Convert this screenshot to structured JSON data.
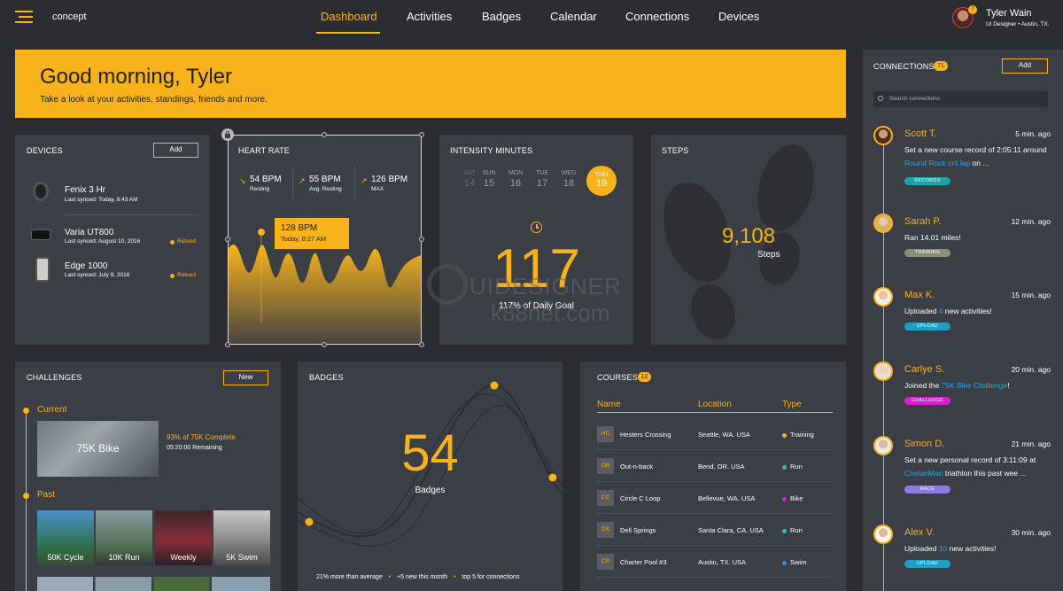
{
  "colors": {
    "accent": "#f8b31c",
    "bg": "#2b2d32",
    "card": "#3b3e45",
    "link": "#29a8e0"
  },
  "header": {
    "app_name": "concept",
    "nav": [
      "Dashboard",
      "Activities",
      "Badges",
      "Calendar",
      "Connections",
      "Devices"
    ],
    "user": {
      "name": "Tyler Wain",
      "subtitle": "UI Designer • Austin, TX.",
      "notification_count": "7"
    }
  },
  "greeting": {
    "title": "Good morning, Tyler",
    "subtitle": "Take a look at your activities, standings, friends and more."
  },
  "devices": {
    "title": "DEVICES",
    "add_label": "Add",
    "items": [
      {
        "name": "Fenix 3 Hr",
        "synced": "Last synced: Today, 8:43 AM",
        "status": ""
      },
      {
        "name": "Varia UT800",
        "synced": "Last synced: August 10, 2016",
        "status": "Retired"
      },
      {
        "name": "Edge 1000",
        "synced": "Last synced: July 9, 2016",
        "status": "Retired"
      }
    ]
  },
  "heart_rate": {
    "title": "HEART RATE",
    "stats": [
      {
        "value": "54 BPM",
        "label": "Resting"
      },
      {
        "value": "55 BPM",
        "label": "Avg. Resting"
      },
      {
        "value": "126 BPM",
        "label": "MAX"
      }
    ],
    "tooltip": {
      "value": "128 BPM",
      "time": "Today, 8:27 AM"
    }
  },
  "intensity": {
    "title": "INTENSITY MINUTES",
    "days": [
      {
        "dow": "SAT",
        "num": "14"
      },
      {
        "dow": "SUN",
        "num": "15"
      },
      {
        "dow": "MON",
        "num": "16"
      },
      {
        "dow": "TUE",
        "num": "17"
      },
      {
        "dow": "WED",
        "num": "18"
      },
      {
        "dow": "THU",
        "num": "19"
      }
    ],
    "value": "117",
    "caption": "117% of Daily Goal"
  },
  "steps": {
    "title": "STEPS",
    "value": "9,108",
    "label": "Steps"
  },
  "challenges": {
    "title": "CHALLENGES",
    "new_label": "New",
    "current_label": "Current",
    "current": {
      "name": "75K Bike",
      "progress": "93% of 75K Complete",
      "remaining": "05:20:00 Remaining"
    },
    "past_label": "Past",
    "past": [
      "50K Cycle",
      "10K Run",
      "Weekly",
      "5K Swim"
    ]
  },
  "badges": {
    "title": "BADGES",
    "value": "54",
    "label": "Badges",
    "footer": [
      "21% more than average",
      "+5 new this month",
      "top 5 for connections"
    ]
  },
  "courses": {
    "title": "COURSES",
    "count": "12",
    "columns": [
      "Name",
      "Location",
      "Type"
    ],
    "rows": [
      {
        "abbr": "HC",
        "name": "Hesters Crossing",
        "location": "Seattle, WA. USA",
        "type": "Training",
        "color": "#f8b31c"
      },
      {
        "abbr": "OB",
        "name": "Out-n-back",
        "location": "Bend, OR. USA",
        "type": "Run",
        "color": "#29c4b8"
      },
      {
        "abbr": "CC",
        "name": "Circle C Loop",
        "location": "Bellevue, WA. USA",
        "type": "Bike",
        "color": "#d41fd4"
      },
      {
        "abbr": "DS",
        "name": "Dell Springs",
        "location": "Santa Clara, CA. USA",
        "type": "Run",
        "color": "#29c4b8"
      },
      {
        "abbr": "CP",
        "name": "Charter Pool #3",
        "location": "Austin, TX. USA",
        "type": "Swim",
        "color": "#2b8ee8"
      }
    ]
  },
  "connections": {
    "title": "CONNECTIONS",
    "count": "71",
    "add_label": "Add",
    "search_placeholder": "Search connections",
    "items": [
      {
        "name": "Scott T.",
        "time": "5 min. ago",
        "text_a": "Set a new course record of 2:05:11 around ",
        "link": "Round Rock crit lap",
        "text_b": " on ...",
        "badge": "RECORDS",
        "badge_color": "#1fa3a8"
      },
      {
        "name": "Sarah P.",
        "time": "12 min. ago",
        "text_a": "Ran 14.01 miles!",
        "link": "",
        "text_b": "",
        "badge": "TRAINING",
        "badge_color": "#8c8f77"
      },
      {
        "name": "Max K.",
        "time": "15 min. ago",
        "text_a": "Uploaded ",
        "link": "4",
        "text_b": " new activities!",
        "badge": "UPLOAD",
        "badge_color": "#1f9fbf"
      },
      {
        "name": "Carlye S.",
        "time": "20 min. ago",
        "text_a": "Joined the ",
        "link": "75K Bike Challenge",
        "text_b": "!",
        "badge": "CHALLENGE",
        "badge_color": "#d41fd4"
      },
      {
        "name": "Simon D.",
        "time": "21 min. ago",
        "text_a": "Set a new personal record of 3:11:09 at ",
        "link": "ChelanMan",
        "text_b": " triathlon this past wee ...",
        "badge": "RACE",
        "badge_color": "#8d7be0"
      },
      {
        "name": "Alex V.",
        "time": "30 min. ago",
        "text_a": "Uploaded ",
        "link": "10",
        "text_b": " new activities!",
        "badge": "UPLOAD",
        "badge_color": "#1f9fbf"
      }
    ]
  },
  "watermark": {
    "line1": "UIDESIGNER",
    "line2": "k88net.com"
  }
}
